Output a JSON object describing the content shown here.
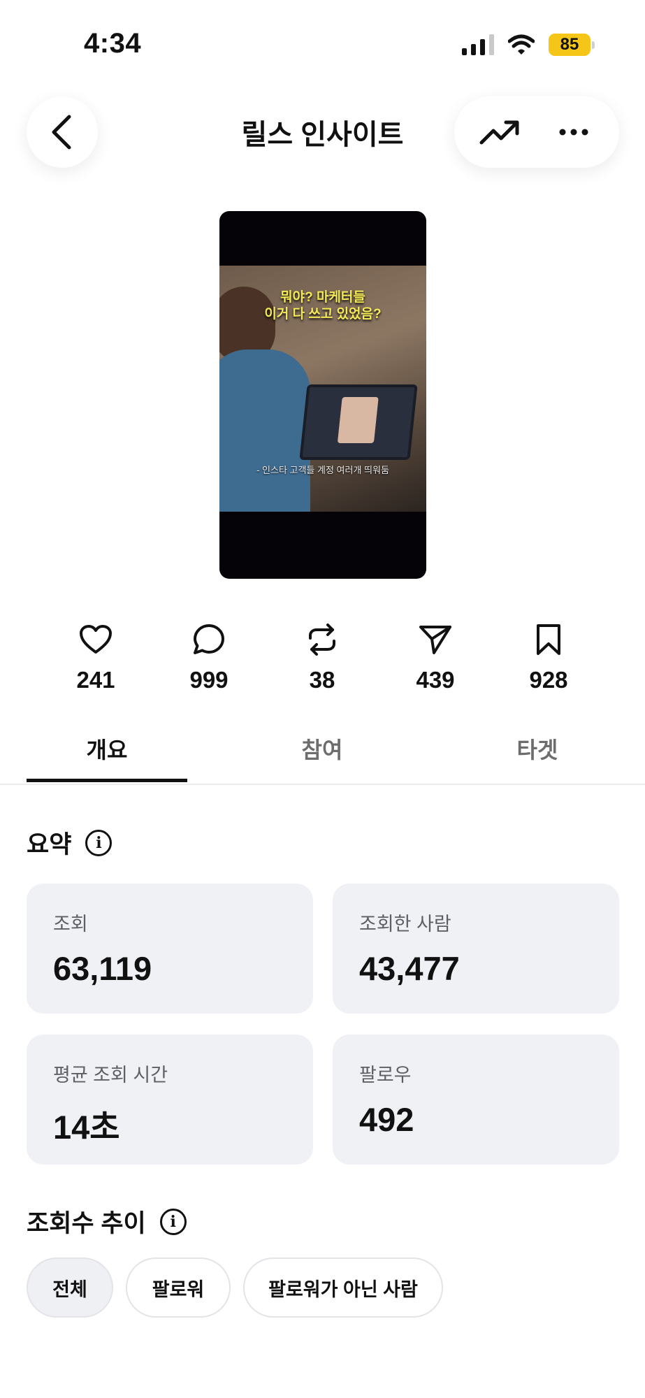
{
  "status_bar": {
    "time": "4:34",
    "battery": "85",
    "icons": [
      "signal-icon",
      "wifi-icon",
      "battery-icon"
    ]
  },
  "header": {
    "title": "릴스 인사이트",
    "back_icon": "chevron-left-icon",
    "trend_icon": "trending-up-icon",
    "more_icon": "more-horizontal-icon"
  },
  "thumbnail": {
    "caption_line1": "뭐야? 마케터들",
    "caption_line2": "이거 다 쓰고 있었음?",
    "subcaption": "- 인스타 고객들 계정 여러개 띄워둠"
  },
  "stats": [
    {
      "icon": "heart-icon",
      "value": "241"
    },
    {
      "icon": "comment-icon",
      "value": "999"
    },
    {
      "icon": "repost-icon",
      "value": "38"
    },
    {
      "icon": "send-icon",
      "value": "439"
    },
    {
      "icon": "bookmark-icon",
      "value": "928"
    }
  ],
  "tabs": [
    {
      "label": "개요",
      "active": true
    },
    {
      "label": "참여",
      "active": false
    },
    {
      "label": "타겟",
      "active": false
    }
  ],
  "summary": {
    "title": "요약",
    "cards": [
      {
        "label": "조회",
        "value": "63,119"
      },
      {
        "label": "조회한 사람",
        "value": "43,477"
      },
      {
        "label": "평균 조회 시간",
        "value": "14초"
      },
      {
        "label": "팔로우",
        "value": "492"
      }
    ]
  },
  "trend": {
    "title": "조회수 추이",
    "chips": [
      {
        "label": "전체",
        "active": true
      },
      {
        "label": "팔로워",
        "active": false
      },
      {
        "label": "팔로워가 아닌 사람",
        "active": false
      }
    ]
  },
  "colors": {
    "card_bg": "#f0f1f5",
    "battery": "#f5c518",
    "caption": "#f3ea55"
  }
}
